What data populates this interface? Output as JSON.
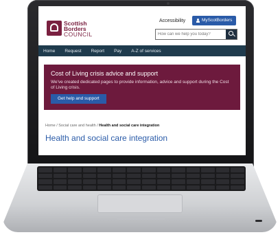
{
  "site": {
    "logo_line1": "Scottish",
    "logo_line2": "Borders",
    "logo_line3": "COUNCIL",
    "accessibility": "Accessibility",
    "account_button": "MyScotBorders"
  },
  "search": {
    "placeholder": "How can we help you today?"
  },
  "nav": {
    "items": [
      {
        "label": "Home"
      },
      {
        "label": "Request"
      },
      {
        "label": "Report"
      },
      {
        "label": "Pay"
      },
      {
        "label": "A-Z of services"
      }
    ]
  },
  "banner": {
    "title": "Cost of Living crisis advice and support",
    "text": "We've created dedicated pages to provide information, advice and support during the Cost of Living crisis.",
    "button": "Get help and support"
  },
  "breadcrumb": {
    "home": "Home",
    "sep1": " / ",
    "section": "Social care and health",
    "sep2": " / ",
    "current": "Health and social care integration"
  },
  "page": {
    "title": "Health and social care integration"
  },
  "colors": {
    "brand": "#7a2040",
    "banner": "#6d1a3d",
    "nav": "#1f3b4d",
    "accent": "#2a5ba8"
  }
}
